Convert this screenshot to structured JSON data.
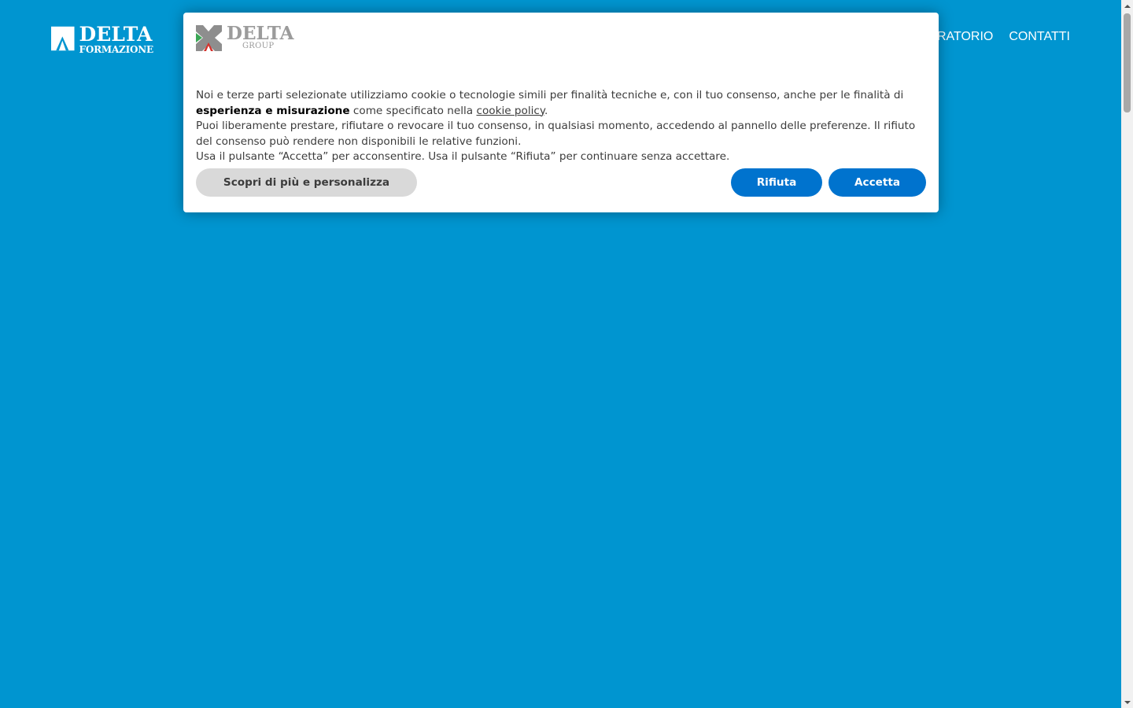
{
  "site": {
    "logo": {
      "line1": "DELTA",
      "line2": "FORMAZIONE"
    },
    "nav": [
      {
        "label": "RATORIO"
      },
      {
        "label": "CONTATTI"
      }
    ],
    "background_color": "#0095D0"
  },
  "cookie_banner": {
    "logo": {
      "line1": "DELTA",
      "line2": "GROUP"
    },
    "text": {
      "p1_before": "Noi e terze parti selezionate utilizziamo cookie o tecnologie simili per finalità tecniche e, con il tuo consenso, anche per le finalità di ",
      "p1_strong": "esperienza e misurazione",
      "p1_middle": " come specificato nella ",
      "p1_link": "cookie policy",
      "p1_after": ".",
      "p2": "Puoi liberamente prestare, rifiutare o revocare il tuo consenso, in qualsiasi momento, accedendo al pannello delle preferenze. Il rifiuto del consenso può rendere non disponibili le relative funzioni.",
      "p3": "Usa il pulsante “Accetta” per acconsentire. Usa il pulsante “Rifiuta” per continuare senza accettare."
    },
    "buttons": {
      "customize": "Scopri di più e personalizza",
      "reject": "Rifiuta",
      "accept": "Accetta"
    },
    "accent_color": "#0073CE"
  }
}
